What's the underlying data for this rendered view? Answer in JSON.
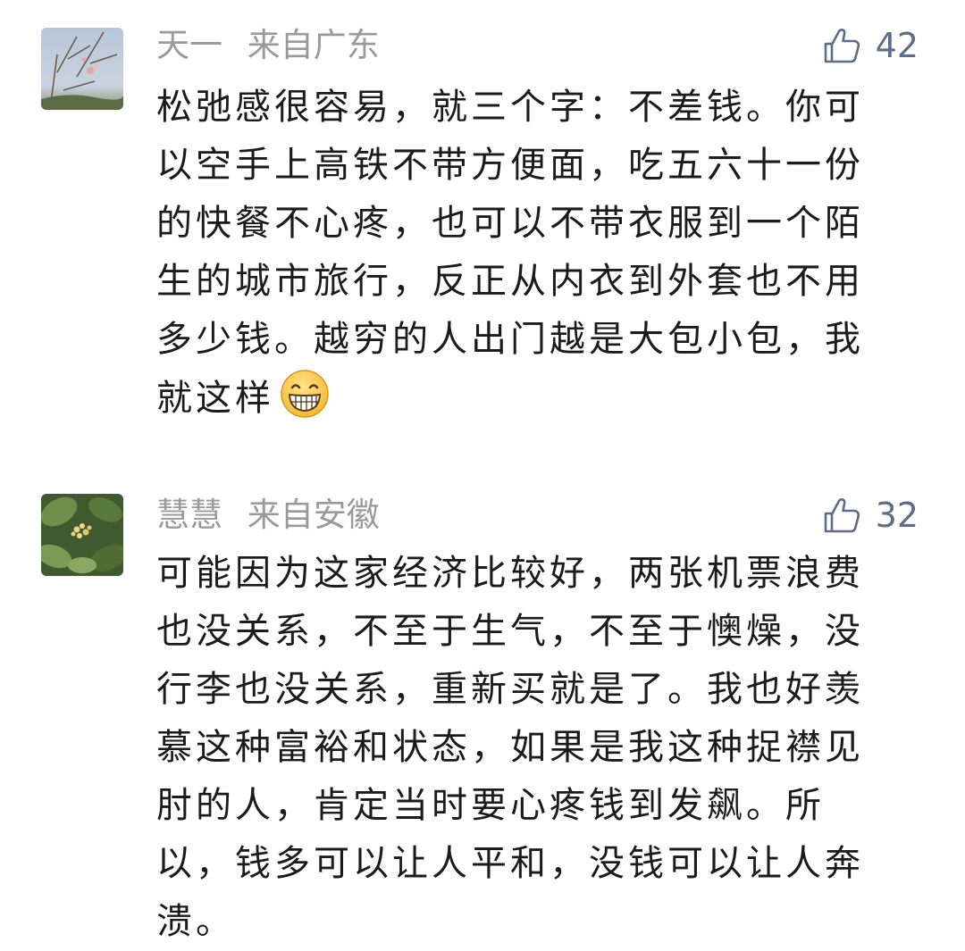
{
  "comments": [
    {
      "name": "天一",
      "location": "来自广东",
      "likes": "42",
      "text": "松弛感很容易，就三个字：不差钱。你可以空手上高铁不带方便面，吃五六十一份的快餐不心疼，也可以不带衣服到一个陌生的城市旅行，反正从内衣到外套也不用多少钱。越穷的人出门越是大包小包，我就这样",
      "emoji": "grinning-emoji"
    },
    {
      "name": "慧慧",
      "location": "来自安徽",
      "likes": "32",
      "text": "可能因为这家经济比较好，两张机票浪费也没关系，不至于生气，不至于懊燥，没行李也没关系，重新买就是了。我也好羡慕这种富裕和状态，如果是我这种捉襟见肘的人，肯定当时要心疼钱到发飙。所以，钱多可以让人平和，没钱可以让人奔溃。"
    }
  ],
  "colors": {
    "meta": "#9a9a9a",
    "like": "#5c6c8a",
    "text": "#1b1b1b"
  },
  "icons": {
    "like": "thumbs-up-icon"
  }
}
